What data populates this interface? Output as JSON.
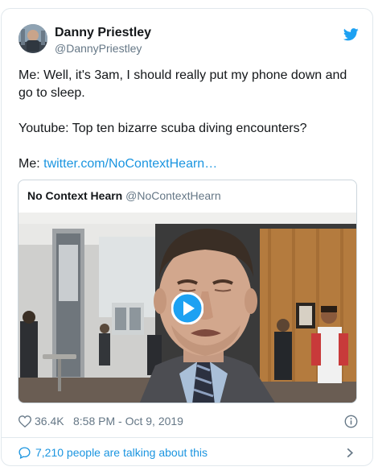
{
  "tweet": {
    "author": {
      "name": "Danny Priestley",
      "handle": "@DannyPriestley"
    },
    "brand_icon": "twitter-bird-icon",
    "text_lines": [
      "Me: Well, it's 3am, I should really put my phone down and go to sleep.",
      "Youtube: Top ten bizarre scuba diving encounters?"
    ],
    "link_prefix": "Me: ",
    "link_text": "twitter.com/NoContextHearn…",
    "likes": "36.4K",
    "timestamp": "8:58 PM - Oct 9, 2019",
    "talking": "7,210 people are talking about this"
  },
  "quoted": {
    "name": "No Context Hearn",
    "handle": "@NoContextHearn",
    "media": "video",
    "play_icon": "play-icon"
  },
  "colors": {
    "brand": "#1da1f2",
    "link": "#1b95e0",
    "secondary_text": "#657786",
    "border": "#e1e8ed"
  }
}
